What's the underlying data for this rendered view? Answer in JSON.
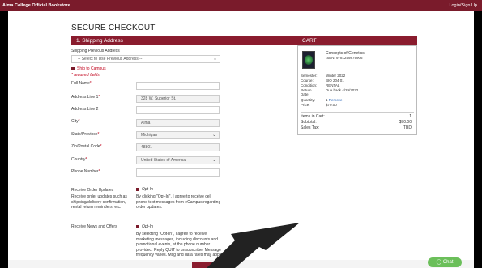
{
  "topbar": {
    "brand": "Alma College Official Bookstore",
    "login": "Login/Sign Up"
  },
  "checkout": {
    "title": "SECURE CHECKOUT",
    "section_header": "1. Shipping Address",
    "prev_address_label": "Shipping Previous Address",
    "prev_address_placeholder": "-- Select to Use Previous Address --",
    "ship_to_campus": "Ship to Campus",
    "required_note": "* required fields",
    "fields": {
      "full_name": {
        "label": "Full Name",
        "value": ""
      },
      "address1": {
        "label": "Address Line 1",
        "value": "328 W. Superior St."
      },
      "address2": {
        "label": "Address Line 2",
        "value": ""
      },
      "city": {
        "label": "City",
        "value": "Alma"
      },
      "state": {
        "label": "State/Province",
        "value": "Michigan"
      },
      "zip": {
        "label": "Zip/Postal Code",
        "value": "48801"
      },
      "country": {
        "label": "Country",
        "value": "United States of America"
      },
      "phone": {
        "label": "Phone Number",
        "value": ""
      }
    },
    "order_updates": {
      "label": "Receive Order Updates",
      "desc": "Receive order updates such as shipping/delivery confirmation, rental return reminders, etc.",
      "optin": "Opt-In",
      "text": "By clicking \"Opt-In\", I agree to receive cell phone text messages from eCampus regarding order updates."
    },
    "news": {
      "label": "Receive News and Offers",
      "optin": "Opt-In",
      "text": "By selecting \"Opt-In\", I agree to receive marketing messages, including discounts and promotional events, at the phone number provided. Reply QUIT to unsubscribe. Message frequency varies. Msg and data rates may apply."
    }
  },
  "cart": {
    "header": "CART",
    "item": {
      "title": "Concepts of Genetics",
      "isbn": "ISBN: 9781259879906",
      "details": [
        {
          "k": "Semester:",
          "v": "Winter 2022"
        },
        {
          "k": "Course:",
          "v": "BIO 204 01"
        },
        {
          "k": "Condition:",
          "v": "RENTAL"
        },
        {
          "k": "Return Date:",
          "v": "Due back 4/29/2022"
        },
        {
          "k": "Quantity:",
          "v": "1",
          "link": "Remove"
        },
        {
          "k": "Price:",
          "v": "$70.00"
        }
      ]
    },
    "totals": [
      {
        "k": "Items in Cart:",
        "v": "1"
      },
      {
        "k": "Subtotal:",
        "v": "$70.00"
      },
      {
        "k": "Sales Tax:",
        "v": "TBD"
      }
    ]
  },
  "chat": {
    "label": "Chat"
  }
}
